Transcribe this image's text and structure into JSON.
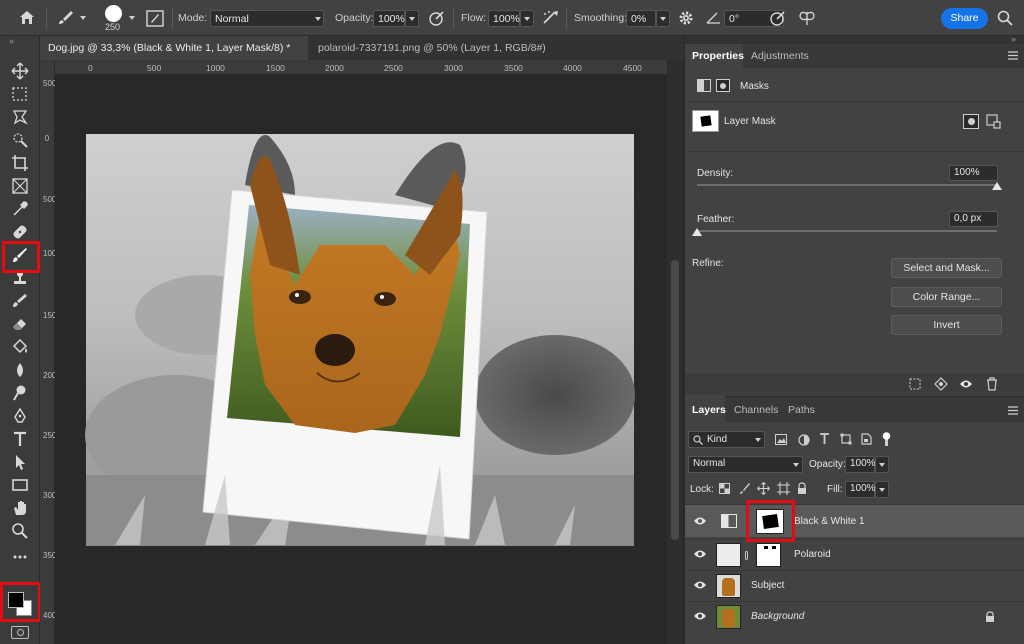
{
  "options_bar": {
    "brush_size": "250",
    "mode_label": "Mode:",
    "mode_value": "Normal",
    "opacity_label": "Opacity:",
    "opacity_value": "100%",
    "flow_label": "Flow:",
    "flow_value": "100%",
    "smoothing_label": "Smoothing:",
    "smoothing_value": "0%",
    "angle_value": "0°",
    "share_label": "Share"
  },
  "tabs": [
    {
      "label": "Dog.jpg @ 33,3% (Black & White 1, Layer Mask/8) *",
      "close": "×",
      "active": true
    },
    {
      "label": "polaroid-7337191.png @ 50% (Layer 1, RGB/8#)",
      "close": "×",
      "active": false
    }
  ],
  "rulers": {
    "top": [
      "0",
      "500",
      "1000",
      "1500",
      "2000",
      "2500",
      "3000",
      "3500",
      "4000",
      "4500"
    ],
    "left": [
      "500",
      "0",
      "500",
      "1000",
      "1500",
      "2000",
      "2500",
      "3000",
      "3500",
      "4000"
    ]
  },
  "properties": {
    "tab_properties": "Properties",
    "tab_adjustments": "Adjustments",
    "masks_label": "Masks",
    "layer_mask_label": "Layer Mask",
    "density_label": "Density:",
    "density_value": "100%",
    "density_level": 1.0,
    "feather_label": "Feather:",
    "feather_value": "0,0 px",
    "feather_level": 0.0,
    "refine_label": "Refine:",
    "select_mask_button": "Select and Mask...",
    "color_range_button": "Color Range...",
    "invert_button": "Invert"
  },
  "layers_panel": {
    "tab_layers": "Layers",
    "tab_channels": "Channels",
    "tab_paths": "Paths",
    "kind_label": "Kind",
    "blend_mode": "Normal",
    "opacity_label": "Opacity:",
    "opacity_value": "100%",
    "lock_label": "Lock:",
    "fill_label": "Fill:",
    "fill_value": "100%",
    "layers": [
      {
        "name": "Black & White 1",
        "selected": true
      },
      {
        "name": "Polaroid",
        "selected": false
      },
      {
        "name": "Subject",
        "selected": false
      },
      {
        "name": "Background",
        "selected": false,
        "locked": true
      }
    ]
  },
  "colors": {
    "highlight": "#e50b12",
    "accent": "#1473e6",
    "panel_bg": "#424242"
  }
}
